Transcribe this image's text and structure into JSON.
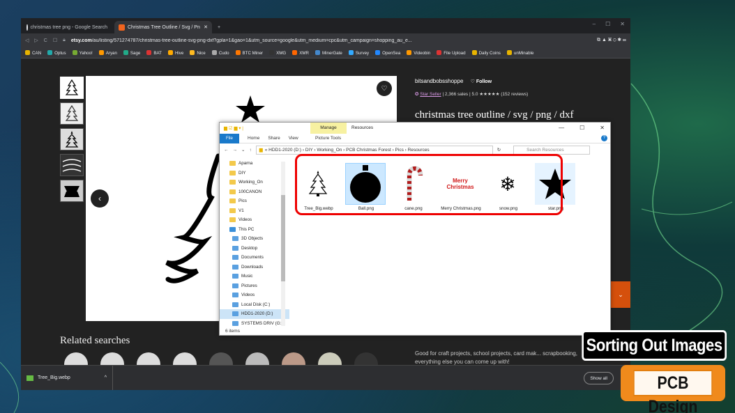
{
  "browser": {
    "tabs": [
      {
        "label": "christmas tree png - Google Search",
        "icon": "google-icon"
      },
      {
        "label": "Christmas Tree Outline / Svg / Pn",
        "icon": "etsy-icon"
      }
    ],
    "url_host": "etsy.com",
    "url_rest": "/au/listing/571274787/christmas-tree-outline-svg-png-dxf?gpla=1&gao=1&utm_source=google&utm_medium=cpc&utm_campaign=shopping_au_e...",
    "bookmarks": [
      "CAN",
      "Optus",
      "Yahoo!",
      "Aryan",
      "Sage",
      "BAT",
      "Hive",
      "Nice",
      "Cudo",
      "BTC Miner",
      "XMG",
      "XMR",
      "MinerGate",
      "Survey",
      "OpenSea",
      "Videobin",
      "File Upload",
      "Daily Coins",
      "unMinable"
    ]
  },
  "etsy": {
    "shop_name": "bitsandbobsshoppe",
    "follow": "Follow",
    "star_seller": "Star Seller",
    "stats": "| 2,366 sales | 5.0 ★★★★★ (152 reviews)",
    "title": "christmas tree outline / svg / png / dxf",
    "related": "Related searches",
    "description": "Good for craft projects, school projects, card mak... scrapbooking, everything else you can come up with!"
  },
  "downloads": {
    "file": "Tree_Big.webp",
    "show_all": "Show all"
  },
  "explorer": {
    "manage": "Manage",
    "title": "Resources",
    "ribbon": [
      "File",
      "Home",
      "Share",
      "View"
    ],
    "picture_tools": "Picture Tools",
    "breadcrumb": "« HDD1-2020 (D:) › DIY › Working_On › PCB Christmas Forest › Pics › Resources",
    "search_placeholder": "Search Resources",
    "nav": [
      "Aparna",
      "DIY",
      "Working_On",
      "100CANON",
      "Pics",
      "V1",
      "Videos",
      "This PC",
      "3D Objects",
      "Desktop",
      "Documents",
      "Downloads",
      "Music",
      "Pictures",
      "Videos",
      "Local Disk (C:)",
      "HDD1-2020 (D:)",
      "SYSTEMS DRIV (G:)"
    ],
    "item_count": "6 items",
    "files": [
      "Tree_Big.webp",
      "Ball.png",
      "cane.png",
      "Merry Christmas.png",
      "snow.png",
      "star.png"
    ],
    "merry_text": "Merry Christmas"
  },
  "overlay": {
    "label1": "Sorting Out Images",
    "label2": "PCB Design"
  }
}
